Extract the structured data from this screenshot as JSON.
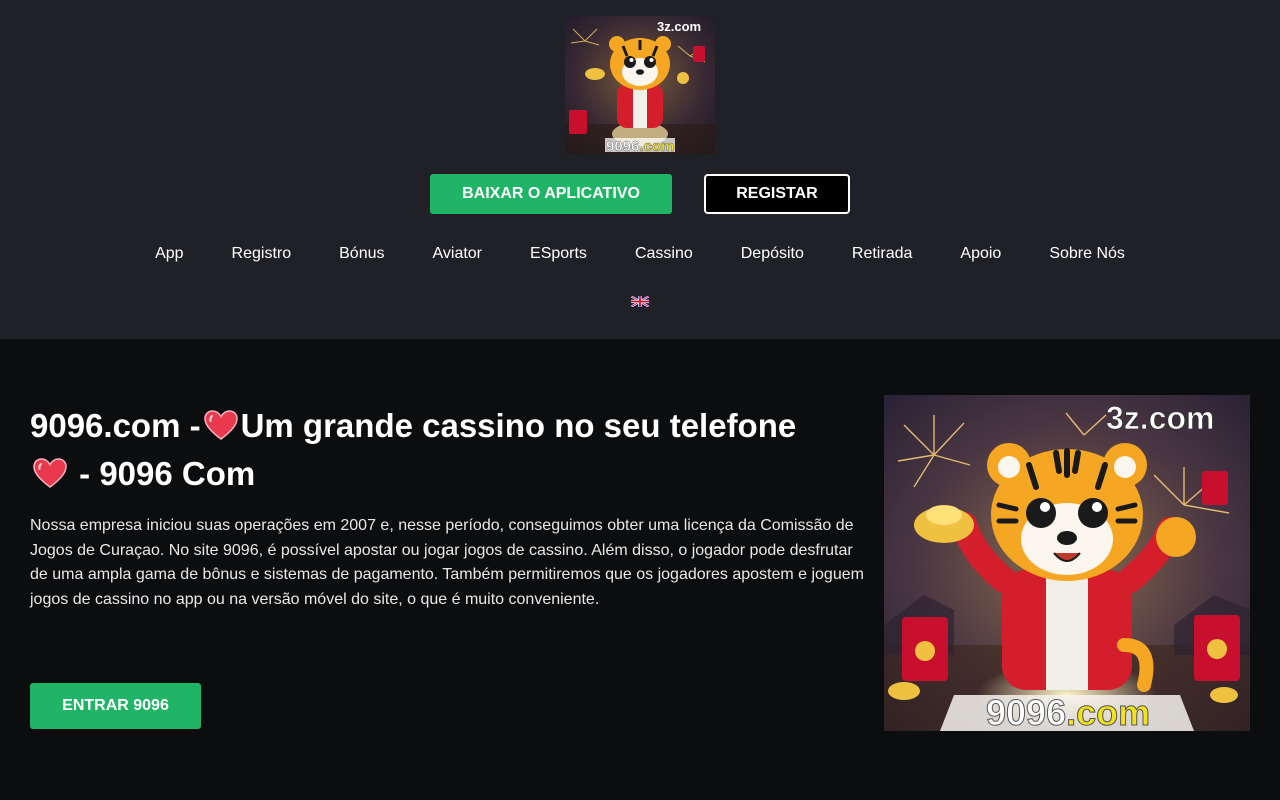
{
  "header": {
    "logo": {
      "brand_tag": "3z.com",
      "domain_main": "9096",
      "domain_suffix": ".com"
    },
    "download_button": "BAIXAR O APLICATIVO",
    "register_button": "REGISTAR",
    "nav": {
      "items": [
        {
          "label": "App"
        },
        {
          "label": "Registro"
        },
        {
          "label": "Bónus"
        },
        {
          "label": "Aviator"
        },
        {
          "label": "ESports"
        },
        {
          "label": "Cassino"
        },
        {
          "label": "Depósito"
        },
        {
          "label": "Retirada"
        },
        {
          "label": "Apoio"
        },
        {
          "label": "Sobre Nós"
        }
      ]
    },
    "language_flag": "uk-flag-icon"
  },
  "hero": {
    "title_part1": "9096.com -",
    "title_part2": "Um grande cassino no seu telefone",
    "title_part3": "- 9096 Com",
    "description": "Nossa empresa iniciou suas operações em 2007 e, nesse período, conseguimos obter uma licença da Comissão de Jogos de Curaçao. No site 9096, é possível apostar ou jogar jogos de cassino. Além disso, o jogador pode desfrutar de uma ampla gama de bônus e sistemas de pagamento. Também permitiremos que os jogadores apostem e joguem jogos de cassino no app ou na versão móvel do site, o que é muito conveniente.",
    "enter_button": "ENTRAR 9096",
    "promo_image": {
      "brand_tag": "3z.com",
      "domain_main": "9096",
      "domain_suffix": ".com"
    }
  },
  "colors": {
    "header_bg": "#1f2126",
    "page_bg": "#0c0d0f",
    "accent_green": "#1fb466",
    "heart": "#e8394f",
    "domain_suffix_yellow": "#f4e21a"
  }
}
